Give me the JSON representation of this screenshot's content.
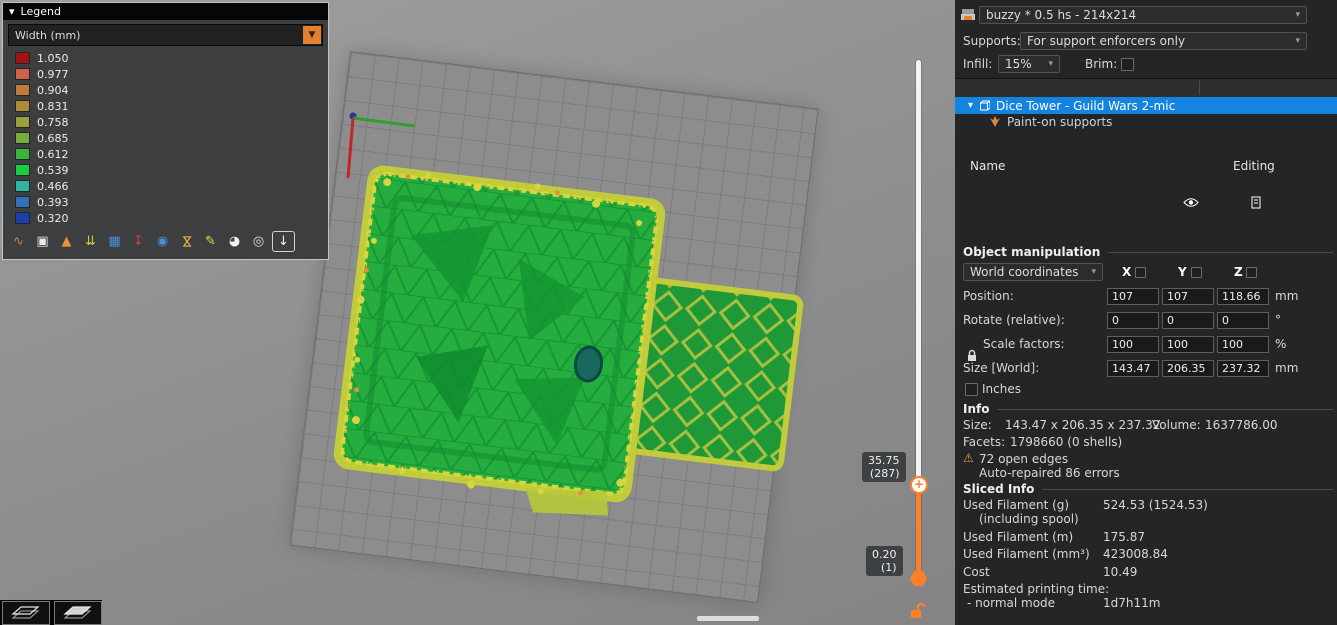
{
  "icons": {
    "chevron_down": "▾",
    "triangle_down": "▼",
    "warning": "⚠",
    "plus": "+"
  },
  "legend": {
    "title": "Legend",
    "view_mode": "Width (mm)",
    "scale": [
      {
        "value": "1.050",
        "color": "#a51212"
      },
      {
        "value": "0.977",
        "color": "#d2604a"
      },
      {
        "value": "0.904",
        "color": "#c07a3c"
      },
      {
        "value": "0.831",
        "color": "#ad8d3a"
      },
      {
        "value": "0.758",
        "color": "#9aa03a"
      },
      {
        "value": "0.685",
        "color": "#76ad3a"
      },
      {
        "value": "0.612",
        "color": "#3bb43b"
      },
      {
        "value": "0.539",
        "color": "#18cf40"
      },
      {
        "value": "0.466",
        "color": "#2fb3a3"
      },
      {
        "value": "0.393",
        "color": "#2f72b8"
      },
      {
        "value": "0.320",
        "color": "#1a3fae"
      }
    ],
    "toolbar": [
      {
        "glyph": "∿",
        "color": "#e07b30"
      },
      {
        "glyph": "▣",
        "color": "#e8e8e8"
      },
      {
        "glyph": "▲",
        "color": "#e8953a"
      },
      {
        "glyph": "⇊",
        "color": "#d8c838"
      },
      {
        "glyph": "▦",
        "color": "#4a8fd8"
      },
      {
        "glyph": "↧",
        "color": "#d04040"
      },
      {
        "glyph": "◉",
        "color": "#4a8fd8"
      },
      {
        "glyph": "⋈",
        "color": "#e8b838"
      },
      {
        "glyph": "✎",
        "color": "#e8d44a"
      },
      {
        "glyph": "◕",
        "color": "#f0f0f0"
      },
      {
        "glyph": "◎",
        "color": "#e0e0e0"
      },
      {
        "glyph": "↓",
        "color": "#f0f0f0"
      }
    ]
  },
  "viewport": {
    "slider": {
      "upper_value": "35.75",
      "upper_layer": "(287)",
      "lower_value": "0.20",
      "lower_layer": "(1)"
    }
  },
  "right_panel": {
    "printer_preset": "buzzy * 0.5 hs - 214x214",
    "supports_label": "Supports:",
    "supports_value": "For support enforcers only",
    "infill_label": "Infill:",
    "infill_value": "15%",
    "brim_label": "Brim:",
    "table": {
      "name_header": "Name",
      "editing_header": "Editing"
    },
    "object": {
      "name": "Dice Tower - Guild Wars 2-mic",
      "child": "Paint-on supports"
    },
    "manip": {
      "title": "Object manipulation",
      "coords": "World coordinates",
      "axis_x": "X",
      "axis_y": "Y",
      "axis_z": "Z",
      "position": {
        "label": "Position:",
        "x": "107",
        "y": "107",
        "z": "118.66",
        "unit": "mm"
      },
      "rotate": {
        "label": "Rotate (relative):",
        "x": "0",
        "y": "0",
        "z": "0",
        "unit": "°"
      },
      "scale": {
        "label": "Scale factors:",
        "x": "100",
        "y": "100",
        "z": "100",
        "unit": "%"
      },
      "size": {
        "label": "Size [World]:",
        "x": "143.47",
        "y": "206.35",
        "z": "237.32",
        "unit": "mm"
      },
      "inches_label": "Inches"
    },
    "info": {
      "title": "Info",
      "size_label": "Size:",
      "size_value": "143.47 x 206.35 x 237.32",
      "volume_label": "Volume:",
      "volume_value": "1637786.00",
      "facets_label": "Facets:",
      "facets_value": "1798660 (0 shells)",
      "warning": "72 open edges",
      "repaired": "Auto-repaired 86 errors"
    },
    "sliced": {
      "title": "Sliced Info",
      "fil_g_label": "Used Filament (g)",
      "fil_g_sub": "(including spool)",
      "fil_g_value": "524.53 (1524.53)",
      "fil_m_label": "Used Filament (m)",
      "fil_m_value": "175.87",
      "fil_mm3_label": "Used Filament (mm³)",
      "fil_mm3_value": "423008.84",
      "cost_label": "Cost",
      "cost_value": "10.49",
      "time_label": "Estimated printing time:",
      "normal_label": "- normal mode",
      "normal_value": "1d7h11m"
    }
  }
}
